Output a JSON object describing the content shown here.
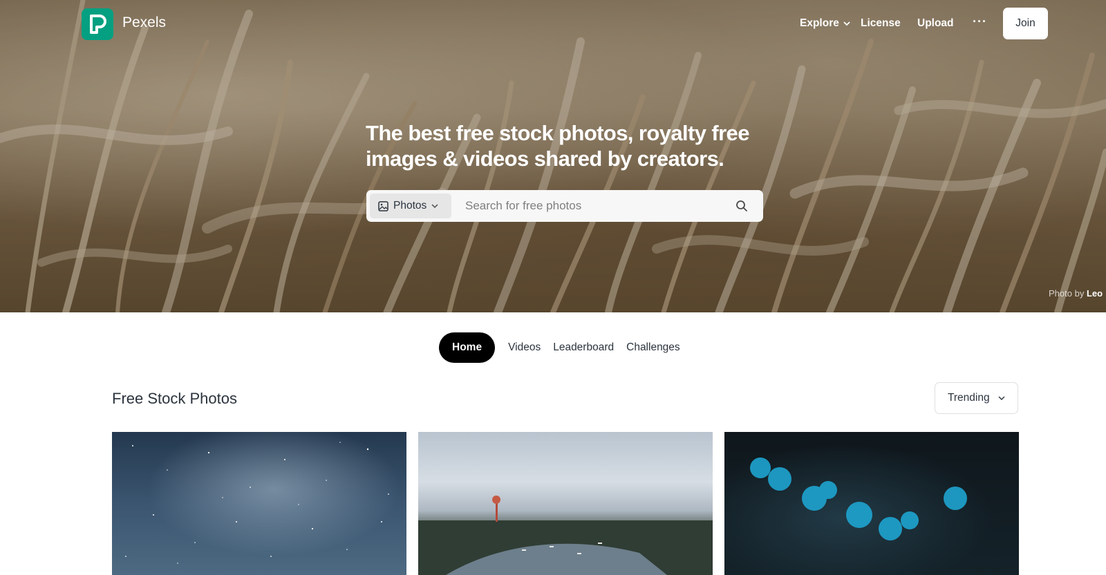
{
  "brand": {
    "name": "Pexels",
    "accent": "#05a081"
  },
  "nav": {
    "explore": "Explore",
    "license": "License",
    "upload": "Upload",
    "more": "···",
    "join": "Join"
  },
  "hero": {
    "headline": "The best free stock photos, royalty free images & videos shared by creators.",
    "search_type": "Photos",
    "search_placeholder": "Search for free photos",
    "credit_prefix": "Photo by",
    "credit_name": "Leo"
  },
  "tabs": [
    {
      "label": "Home",
      "active": true
    },
    {
      "label": "Videos",
      "active": false
    },
    {
      "label": "Leaderboard",
      "active": false
    },
    {
      "label": "Challenges",
      "active": false
    }
  ],
  "section": {
    "title": "Free Stock Photos",
    "sort": "Trending"
  },
  "photos": [
    {
      "subject": "starry night sky"
    },
    {
      "subject": "harbor town aerial"
    },
    {
      "subject": "blue glowing spheres"
    }
  ]
}
